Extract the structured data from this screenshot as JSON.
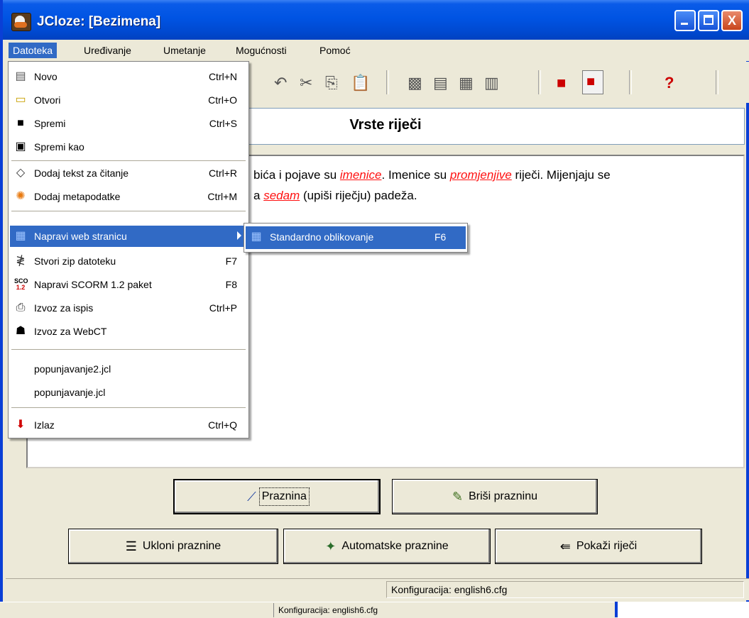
{
  "window": {
    "title": "JCloze: [Bezimena]",
    "buttons": {
      "minimize": "_",
      "maximize": "□",
      "close": "X"
    }
  },
  "menubar": [
    "Datoteka",
    "Uređivanje",
    "Umetanje",
    "Mogućnosti",
    "Pomoć"
  ],
  "file_menu": {
    "items": [
      {
        "label": "Novo",
        "shortcut": "Ctrl+N",
        "icon": "new-document-icon"
      },
      {
        "label": "Otvori",
        "shortcut": "Ctrl+O",
        "icon": "open-folder-icon"
      },
      {
        "label": "Spremi",
        "shortcut": "Ctrl+S",
        "icon": "save-disk-icon"
      },
      {
        "label": "Spremi kao",
        "shortcut": "",
        "icon": "save-as-icon"
      },
      {
        "label": "Dodaj tekst za čitanje",
        "shortcut": "Ctrl+R",
        "icon": "reading-text-icon"
      },
      {
        "label": "Dodaj metapodatke",
        "shortcut": "Ctrl+M",
        "icon": "metadata-icon"
      },
      {
        "label": "Napravi web stranicu",
        "shortcut": "",
        "icon": "web-page-icon"
      },
      {
        "label": "Stvori zip datoteku",
        "shortcut": "F7",
        "icon": "zip-icon"
      },
      {
        "label": "Napravi SCORM 1.2 paket",
        "shortcut": "F8",
        "icon": "scorm-icon"
      },
      {
        "label": "Izvoz za ispis",
        "shortcut": "Ctrl+P",
        "icon": "printer-icon"
      },
      {
        "label": "Izvoz za WebCT",
        "shortcut": "",
        "icon": "webct-icon"
      },
      {
        "label": "popunjavanje2.jcl",
        "shortcut": "",
        "icon": ""
      },
      {
        "label": "popunjavanje.jcl",
        "shortcut": "",
        "icon": ""
      },
      {
        "label": "Izlaz",
        "shortcut": "Ctrl+Q",
        "icon": "exit-arrow-icon"
      }
    ],
    "submenu": {
      "label": "Standardno oblikovanje",
      "shortcut": "F6",
      "icon": "web-format-icon"
    }
  },
  "document": {
    "title": "Vrste riječi",
    "line1": [
      {
        "text": "bića i pojave su ",
        "gap": false
      },
      {
        "text": "imenice",
        "gap": true
      },
      {
        "text": ". Imenice su ",
        "gap": false
      },
      {
        "text": "promjenjive",
        "gap": true
      },
      {
        "text": " riječi. Mijenjaju se",
        "gap": false
      }
    ],
    "line2": [
      {
        "text": "a ",
        "gap": false
      },
      {
        "text": "sedam",
        "gap": true
      },
      {
        "text": " (upiši riječju) padeža.",
        "gap": false
      }
    ]
  },
  "buttons": {
    "gap": "Praznina",
    "delete_gap": "Briši prazninu",
    "clear_gaps": "Ukloni praznine",
    "auto_gaps": "Automatske praznine",
    "show_words": "Pokaži riječi"
  },
  "status": "Konfiguracija: english6.cfg",
  "status_ghost": "Konfiguracija: english6.cfg",
  "toolbar": {
    "help_glyph": "?"
  },
  "colors": {
    "titlebar": "#0054e3",
    "menu_highlight": "#316ac5",
    "gap_text": "#ff1010"
  }
}
